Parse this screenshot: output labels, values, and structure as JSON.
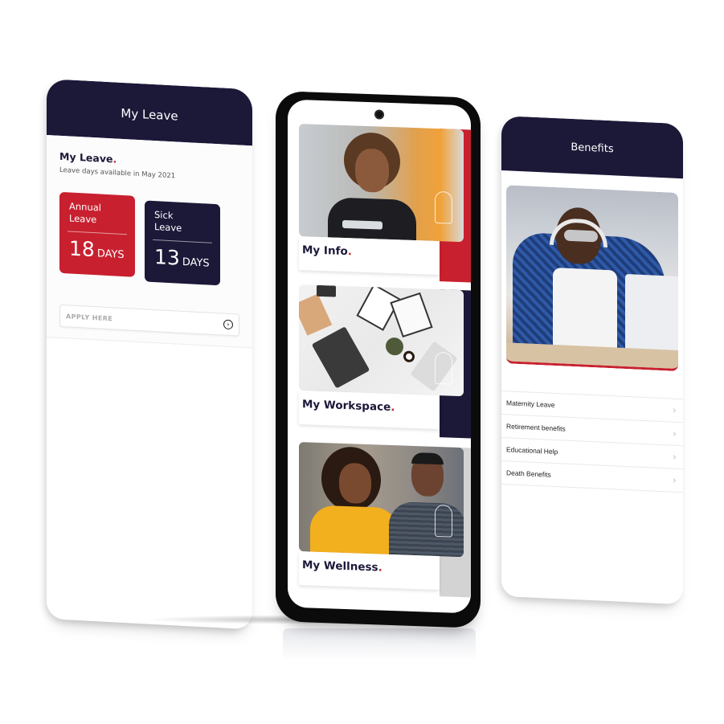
{
  "leave_screen": {
    "header_title": "My Leave",
    "section_title": "My Leave",
    "section_title_dot": ".",
    "subtitle": "Leave days available in May 2021",
    "cards": [
      {
        "label_line1": "Annual",
        "label_line2": "Leave",
        "days": "18",
        "unit": "DAYS",
        "color": "#c8202f"
      },
      {
        "label_line1": "Sick",
        "label_line2": "Leave",
        "days": "13",
        "unit": "DAYS",
        "color": "#1b1838"
      }
    ],
    "apply_field": {
      "placeholder": "APPLY HERE",
      "icon": "arrow-circle-right-icon",
      "icon_glyph": "›"
    }
  },
  "home_screen": {
    "tiles": [
      {
        "label": "My Info",
        "dot": ".",
        "accent": "#c8202f"
      },
      {
        "label": "My Workspace",
        "dot": ".",
        "accent": "#1b1838"
      },
      {
        "label": "My Wellness",
        "dot": ".",
        "accent": "#d3d3d3"
      }
    ]
  },
  "benefits_screen": {
    "header_title": "Benefits",
    "items": [
      {
        "label": "Maternity Leave",
        "chevron": "›"
      },
      {
        "label": "Retirement benefits",
        "chevron": "›"
      },
      {
        "label": "Educational Help",
        "chevron": "›"
      },
      {
        "label": "Death Benefits",
        "chevron": "›"
      }
    ]
  },
  "colors": {
    "navy": "#1b1838",
    "red": "#c8202f",
    "grey": "#d3d3d3"
  }
}
